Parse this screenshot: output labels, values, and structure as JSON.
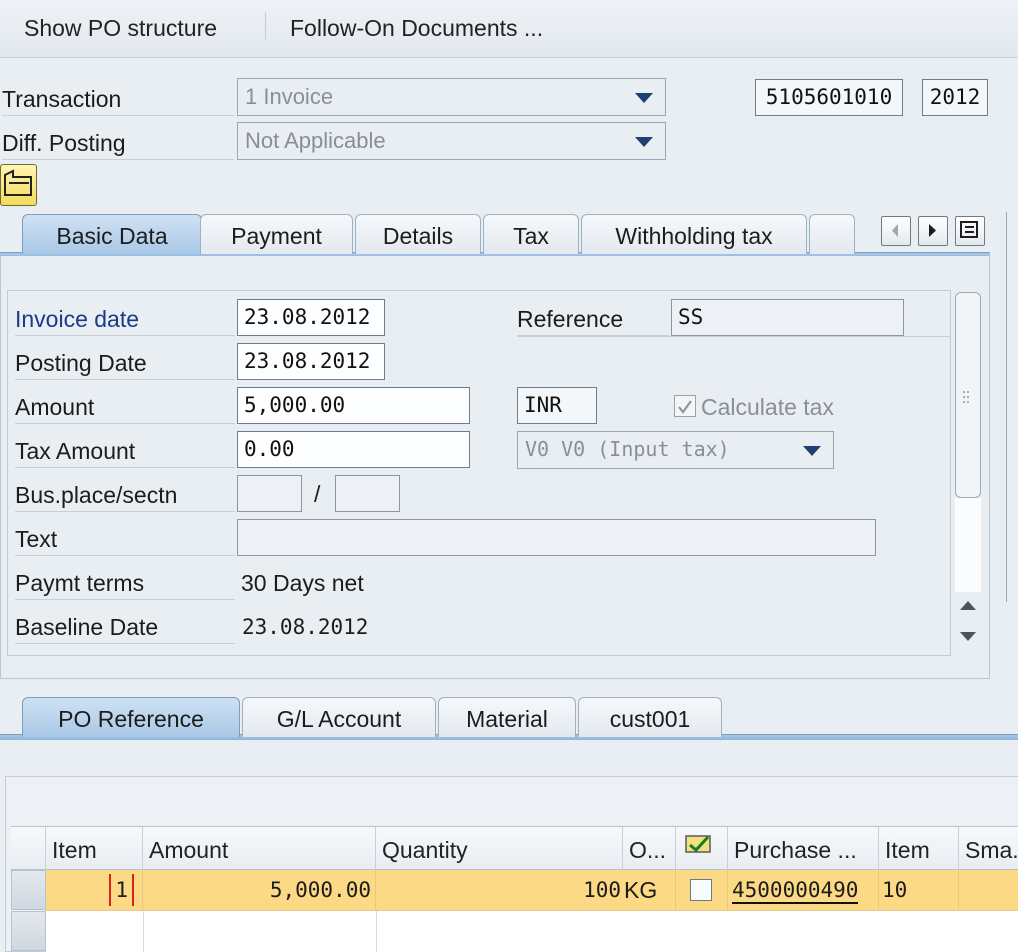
{
  "toolbar": {
    "show_po_structure": "Show PO structure",
    "follow_on_documents": "Follow-On Documents ..."
  },
  "header": {
    "transaction_label": "Transaction",
    "transaction_value": "1 Invoice",
    "diff_posting_label": "Diff. Posting",
    "diff_posting_value": "Not Applicable",
    "document_number": "5105601010",
    "fiscal_year": "2012"
  },
  "tabs": [
    {
      "label": "Basic Data",
      "active": true
    },
    {
      "label": "Payment"
    },
    {
      "label": "Details"
    },
    {
      "label": "Tax"
    },
    {
      "label": "Withholding tax"
    }
  ],
  "basic_data": {
    "invoice_date_label": "Invoice date",
    "invoice_date_value": "23.08.2012",
    "posting_date_label": "Posting Date",
    "posting_date_value": "23.08.2012",
    "amount_label": "Amount",
    "amount_value": "5,000.00",
    "currency_value": "INR",
    "tax_amount_label": "Tax Amount",
    "tax_amount_value": "0.00",
    "bus_place_label": "Bus.place/sectn",
    "bus_place_separator": "/",
    "text_label": "Text",
    "paymt_terms_label": "Paymt terms",
    "paymt_terms_value": "30 Days net",
    "baseline_date_label": "Baseline Date",
    "baseline_date_value": "23.08.2012",
    "reference_label": "Reference",
    "reference_value": "SS",
    "calculate_tax_label": "Calculate tax",
    "tax_code_value": "V0 V0 (Input tax)"
  },
  "bottom_tabs": [
    {
      "label": "PO Reference",
      "active": true
    },
    {
      "label": "G/L Account"
    },
    {
      "label": "Material"
    },
    {
      "label": "cust001"
    }
  ],
  "grid": {
    "columns": [
      "Item",
      "Amount",
      "Quantity",
      "O...",
      "Purchase ...",
      "Item",
      "Sma..."
    ],
    "rows": [
      {
        "item": "1",
        "amount": "5,000.00",
        "quantity": "100",
        "unit": "KG",
        "purchase_order": "4500000490",
        "po_item": "10"
      }
    ]
  },
  "colors": {
    "active_tab": "#a9c8e6",
    "selected_row": "#fbd985",
    "label_blue": "#1a3b8a"
  }
}
